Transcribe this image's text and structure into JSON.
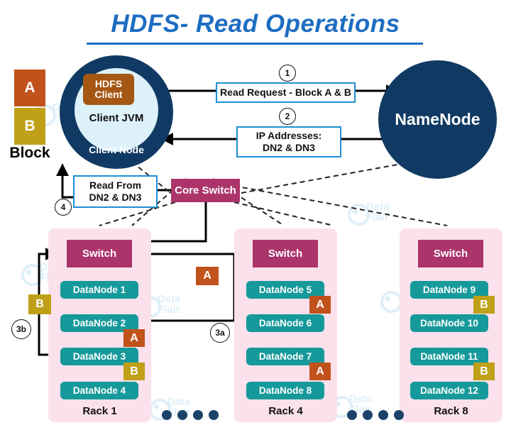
{
  "title": "HDFS- Read Operations",
  "blocks": {
    "label": "Block",
    "items": [
      {
        "name": "A",
        "color": "#C1521B"
      },
      {
        "name": "B",
        "color": "#BFA018"
      }
    ]
  },
  "client": {
    "hdfs_client": "HDFS\nClient",
    "hdfs_client_line1": "HDFS",
    "hdfs_client_line2": "Client",
    "jvm_label": "Client JVM",
    "node_label": "Client Node"
  },
  "namenode": {
    "label": "NameNode"
  },
  "steps": [
    {
      "num": "1",
      "text": "Read Request - Block A & B"
    },
    {
      "num": "2",
      "line1": "IP Addresses:",
      "line2": "DN2 & DN3"
    },
    {
      "num": "3a"
    },
    {
      "num": "3b"
    },
    {
      "num": "4",
      "line1": "Read From",
      "line2": "DN2 & DN3"
    }
  ],
  "step1_text": "Read Request - Block A & B",
  "step2_line1": "IP Addresses:",
  "step2_line2": "DN2 & DN3",
  "step4_line1": "Read From",
  "step4_line2": "DN2 & DN3",
  "step1_num": "1",
  "step2_num": "2",
  "step3a_num": "3a",
  "step3b_num": "3b",
  "step4_num": "4",
  "core_switch": {
    "label": "Core Switch"
  },
  "racks": [
    {
      "id": "rack1",
      "label": "Rack 1",
      "switch_label": "Switch",
      "nodes": [
        {
          "label": "DataNode 1",
          "badge": null
        },
        {
          "label": "DataNode 2",
          "badge": "A"
        },
        {
          "label": "DataNode 3",
          "badge": "B"
        },
        {
          "label": "DataNode 4",
          "badge": null
        }
      ]
    },
    {
      "id": "rack4",
      "label": "Rack 4",
      "switch_label": "Switch",
      "nodes": [
        {
          "label": "DataNode 5",
          "badge": "A"
        },
        {
          "label": "DataNode 6",
          "badge": null
        },
        {
          "label": "DataNode 7",
          "badge": "A"
        },
        {
          "label": "DataNode 8",
          "badge": null
        }
      ]
    },
    {
      "id": "rack8",
      "label": "Rack 8",
      "switch_label": "Switch",
      "nodes": [
        {
          "label": "DataNode 9",
          "badge": "B"
        },
        {
          "label": "DataNode 10",
          "badge": null
        },
        {
          "label": "DataNode 11",
          "badge": "B"
        },
        {
          "label": "DataNode 12",
          "badge": null
        }
      ]
    }
  ],
  "floating_badges": {
    "transfer_a": "A",
    "transfer_b": "B"
  },
  "watermark": {
    "line1": "Data",
    "line2": "Flair"
  },
  "colors": {
    "title": "#1D6DC1",
    "node_navy": "#103A63",
    "switch_magenta": "#AB356B",
    "datanode_teal": "#16999B",
    "rack_pink": "#FBE1EC",
    "block_a": "#C1521B",
    "block_b": "#BFA018",
    "step_border": "#1D8FD1",
    "hdfs_client_brown": "#A55713"
  }
}
